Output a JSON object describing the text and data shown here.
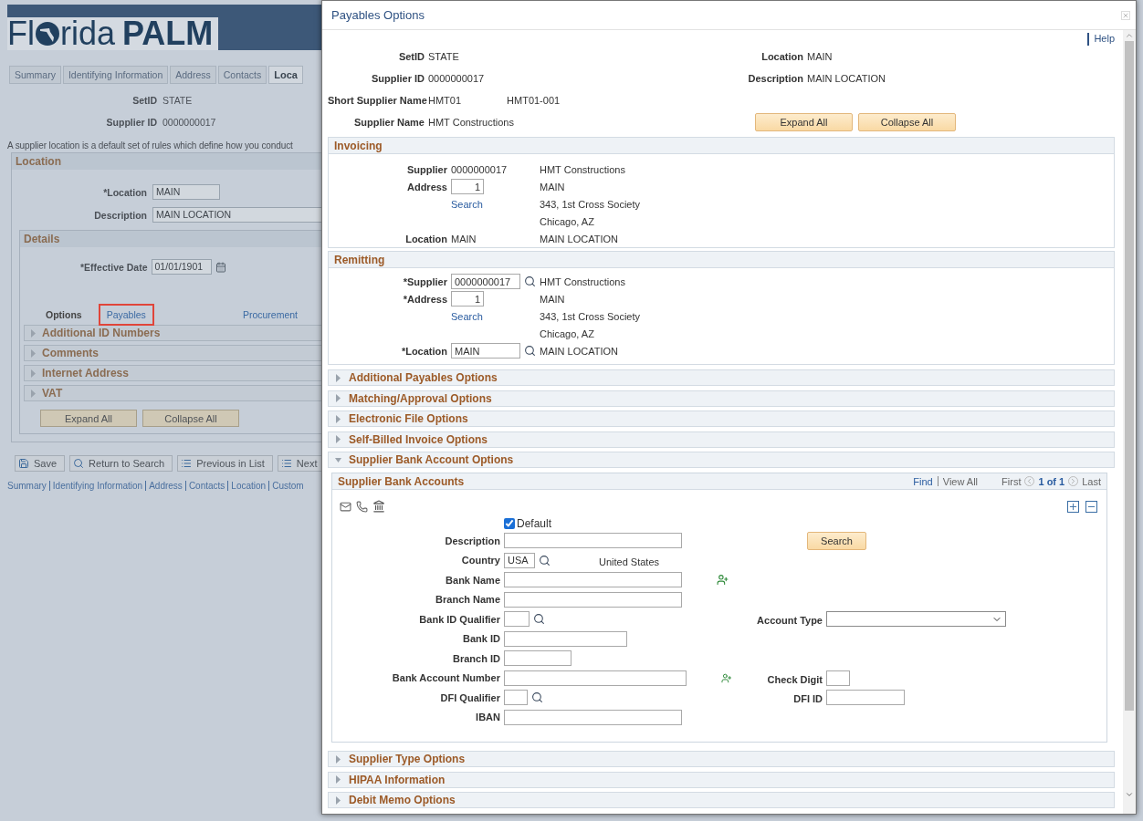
{
  "background_page": {
    "logo": {
      "before": "Fl",
      "after": "rida",
      "bold": "PALM"
    },
    "tabs": [
      {
        "label": "Summary",
        "selected": false
      },
      {
        "label": "Identifying Information",
        "selected": false
      },
      {
        "label": "Address",
        "selected": false
      },
      {
        "label": "Contacts",
        "selected": false
      },
      {
        "label": "Loca",
        "selected": true
      }
    ],
    "fields": [
      {
        "label": "SetID",
        "value": "STATE"
      },
      {
        "label": "Supplier ID",
        "value": "0000000017"
      }
    ],
    "description": "A supplier location is a default set of rules which define how you conduct",
    "location": {
      "title": "Location",
      "fields": [
        {
          "label": "*Location",
          "value": "MAIN"
        },
        {
          "label": "Description",
          "value": "MAIN LOCATION"
        }
      ]
    },
    "details": {
      "title": "Details",
      "effective_date": {
        "label": "*Effective Date",
        "value": "01/01/1901"
      },
      "options_label": "Options",
      "option_links": [
        {
          "label": "Payables",
          "highlighted": true
        },
        {
          "label": "Procurement",
          "highlighted": false
        }
      ],
      "sections": [
        "Additional ID Numbers",
        "Comments",
        "Internet Address",
        "VAT"
      ],
      "buttons": [
        "Expand All",
        "Collapse All"
      ]
    },
    "toolbar": [
      {
        "label": "Save",
        "kind": "save"
      },
      {
        "label": "Return to Search",
        "kind": "search"
      },
      {
        "label": "Previous in List",
        "kind": "previous"
      },
      {
        "label": "Next",
        "kind": "next"
      }
    ],
    "footer_links": [
      "Summary",
      "Identifying Information",
      "Address",
      "Contacts",
      "Location",
      "Custom"
    ]
  },
  "dialog": {
    "title": "Payables Options",
    "help": "Help",
    "header_rows": [
      {
        "left": {
          "label": "SetID",
          "value": "STATE"
        },
        "right": {
          "label": "Location",
          "value": "MAIN"
        }
      },
      {
        "left": {
          "label": "Supplier ID",
          "value": "0000000017"
        },
        "right": {
          "label": "Description",
          "value": "MAIN LOCATION"
        }
      },
      {
        "left": {
          "label": "Short Supplier Name",
          "value": "HMT01",
          "extra": "HMT01-001"
        }
      },
      {
        "left": {
          "label": "Supplier Name",
          "value": "HMT Constructions"
        }
      }
    ],
    "buttons": [
      "Expand All",
      "Collapse All"
    ],
    "invoicing": {
      "title": "Invoicing",
      "rows": [
        {
          "label": "Supplier",
          "kind": "display",
          "value": "0000000017",
          "detail": "HMT Constructions"
        },
        {
          "label": "Address",
          "kind": "input",
          "value": "1",
          "detail": "MAIN"
        },
        {
          "kind": "link",
          "value": "Search",
          "detail": "343, 1st Cross Society"
        },
        {
          "kind": "none",
          "detail": "Chicago, AZ"
        },
        {
          "label": "Location",
          "kind": "display",
          "value": "MAIN",
          "detail": "MAIN LOCATION"
        }
      ]
    },
    "remitting": {
      "title": "Remitting",
      "rows": [
        {
          "label": "*Supplier",
          "kind": "lookup",
          "value": "0000000017",
          "detail": "HMT Constructions"
        },
        {
          "label": "*Address",
          "kind": "input",
          "value": "1",
          "detail": "MAIN"
        },
        {
          "kind": "link",
          "value": "Search",
          "detail": "343, 1st Cross Society"
        },
        {
          "kind": "none",
          "detail": "Chicago, AZ"
        },
        {
          "label": "*Location",
          "kind": "lookup",
          "value": "MAIN",
          "detail": "MAIN LOCATION"
        }
      ]
    },
    "sections": [
      {
        "title": "Additional Payables Options",
        "expanded": false
      },
      {
        "title": "Matching/Approval Options",
        "expanded": false
      },
      {
        "title": "Electronic File Options",
        "expanded": false
      },
      {
        "title": "Self-Billed Invoice Options",
        "expanded": false
      },
      {
        "title": "Supplier Bank Account Options",
        "expanded": true,
        "grid": {
          "title": "Supplier Bank Accounts",
          "nav": {
            "find": "Find",
            "view_all": "View All",
            "first": "First",
            "count": "1 of 1",
            "last": "Last"
          },
          "default": {
            "label": "Default",
            "checked": true
          },
          "rows": [
            {
              "left": {
                "label": "Description",
                "kind": "text"
              },
              "right": {
                "kind": "button",
                "label": "Search"
              }
            },
            {
              "left": {
                "label": "Country",
                "kind": "lookup",
                "value": "USA",
                "detail": "United States"
              }
            },
            {
              "left": {
                "label": "Bank Name",
                "kind": "text",
                "action_icon": true
              }
            },
            {
              "left": {
                "label": "Branch Name",
                "kind": "text"
              }
            },
            {
              "left": {
                "label": "Bank ID Qualifier",
                "kind": "lookup"
              },
              "right": {
                "label": "Account Type",
                "kind": "select"
              }
            },
            {
              "left": {
                "label": "Bank ID",
                "kind": "text"
              }
            },
            {
              "left": {
                "label": "Branch ID",
                "kind": "text"
              }
            },
            {
              "left": {
                "label": "Bank Account Number",
                "kind": "text",
                "action_icon": true
              },
              "right": {
                "label": "Check Digit",
                "kind": "text"
              }
            },
            {
              "left": {
                "label": "DFI Qualifier",
                "kind": "lookup"
              },
              "right": {
                "label": "DFI ID",
                "kind": "text"
              }
            },
            {
              "left": {
                "label": "IBAN",
                "kind": "text"
              }
            }
          ]
        }
      },
      {
        "title": "Supplier Type Options",
        "expanded": false
      },
      {
        "title": "HIPAA Information",
        "expanded": false
      },
      {
        "title": "Debit Memo Options",
        "expanded": false
      }
    ]
  }
}
